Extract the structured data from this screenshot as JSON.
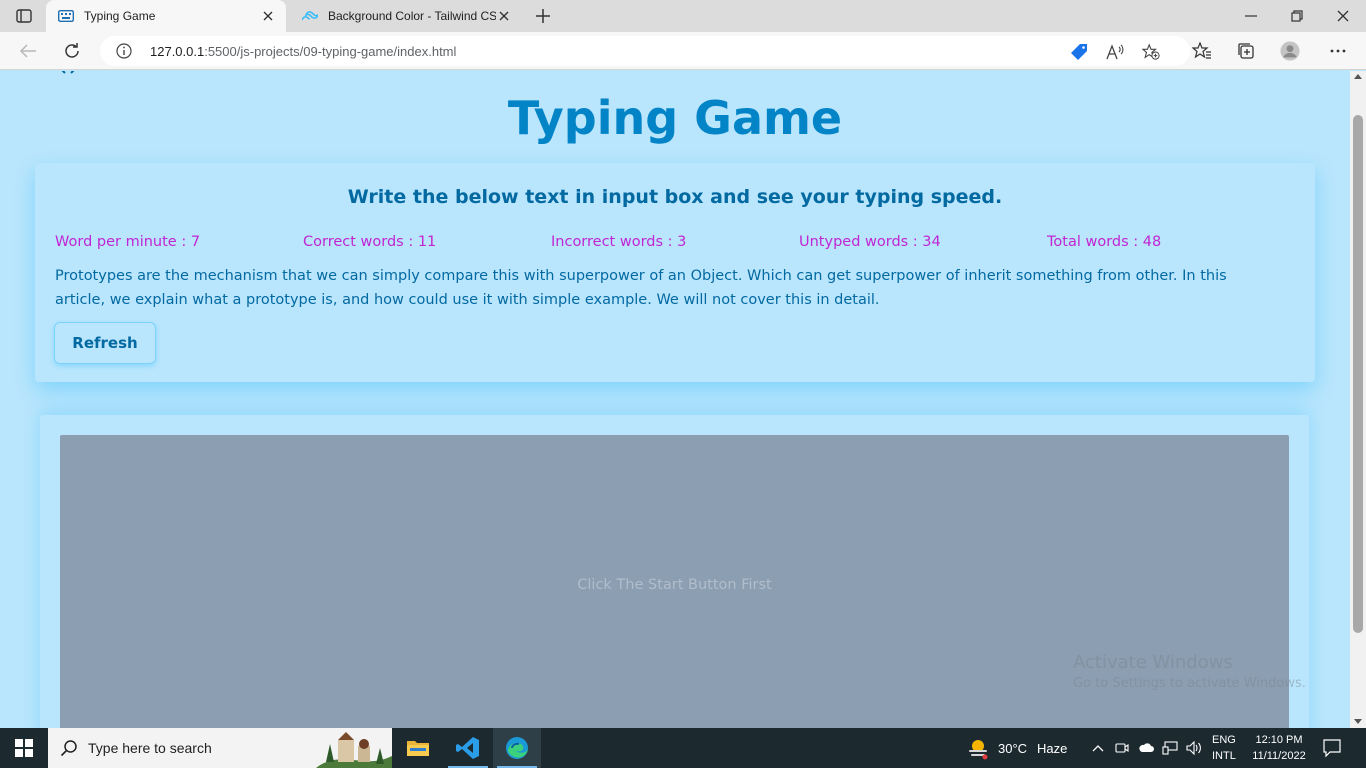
{
  "browser": {
    "tabs": [
      {
        "title": "Typing Game",
        "active": true
      },
      {
        "title": "Background Color - Tailwind CSS",
        "active": false
      }
    ],
    "url": {
      "host": "127.0.0.1",
      "path": ":5500/js-projects/09-typing-game/index.html"
    }
  },
  "page": {
    "title": "Typing Game",
    "card": {
      "heading": "Write the below text in input box and see your typing speed.",
      "stats": {
        "wpm": "Word per minute : 7",
        "correct": "Correct words : 11",
        "incorrect": "Incorrect words : 3",
        "untyped": "Untyped words : 34",
        "total": "Total words : 48"
      },
      "passage": "Prototypes are the mechanism that we can simply compare this with superpower of an Object. Which can get superpower of inherit something from other. In this article, we explain what a prototype is, and how could use it with simple example. We will not cover this in detail.",
      "refresh_label": "Refresh"
    },
    "game": {
      "message": "Click The Start Button First"
    },
    "watermark": {
      "line1": "Activate Windows",
      "line2": "Go to Settings to activate Windows."
    }
  },
  "taskbar": {
    "search_placeholder": "Type here to search",
    "weather": {
      "temp": "30°C",
      "condition": "Haze"
    },
    "lang": {
      "line1": "ENG",
      "line2": "INTL"
    },
    "clock": {
      "time": "12:10 PM",
      "date": "11/11/2022"
    }
  },
  "colors": {
    "page_bg": "#bae6fd",
    "title": "#0284c7",
    "stat_text": "#c026d3",
    "passage_text": "#0369a1",
    "game_area": "#8b9eb2"
  }
}
